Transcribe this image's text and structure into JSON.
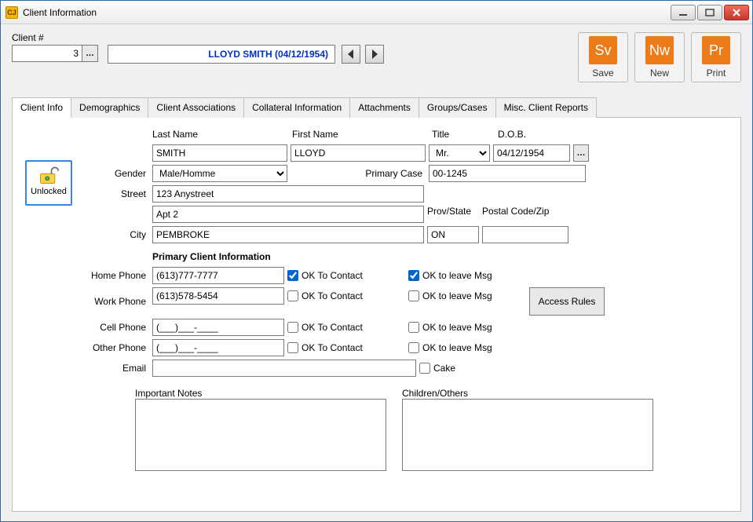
{
  "window": {
    "title": "Client Information"
  },
  "client_number": {
    "label": "Client #",
    "value": "3"
  },
  "banner": {
    "text": "LLOYD SMITH  (04/12/1954)"
  },
  "toolbar": {
    "save": {
      "abbr": "Sv",
      "label": "Save"
    },
    "new": {
      "abbr": "Nw",
      "label": "New"
    },
    "print": {
      "abbr": "Pr",
      "label": "Print"
    }
  },
  "tabs": [
    "Client Info",
    "Demographics",
    "Client Associations",
    "Collateral Information",
    "Attachments",
    "Groups/Cases",
    "Misc. Client Reports"
  ],
  "active_tab": 0,
  "lock": {
    "label": "Unlocked"
  },
  "headers": {
    "last_name": "Last Name",
    "first_name": "First Name",
    "title": "Title",
    "dob": "D.O.B."
  },
  "name": {
    "last": "SMITH",
    "first": "LLOYD",
    "title": "Mr.",
    "dob": "04/12/1954"
  },
  "labels": {
    "gender": "Gender",
    "primary_case": "Primary Case",
    "street": "Street",
    "city": "City",
    "prov": "Prov/State",
    "zip": "Postal Code/Zip",
    "section": "Primary Client Information",
    "home_phone": "Home Phone",
    "work_phone": "Work Phone",
    "cell_phone": "Cell Phone",
    "other_phone": "Other Phone",
    "email": "Email",
    "ok_contact": "OK To Contact",
    "ok_msg": "OK to leave Msg",
    "cake": "Cake",
    "access_rules": "Access Rules",
    "important_notes": "Important Notes",
    "children_others": "Children/Others"
  },
  "gender": "Male/Homme",
  "primary_case": "00-1245",
  "street1": "123 Anystreet",
  "street2": "Apt 2",
  "city": "PEMBROKE",
  "prov": "ON",
  "zip": "",
  "phones": {
    "home": {
      "value": "(613)777-7777",
      "contact": true,
      "msg": true
    },
    "work": {
      "value": "(613)578-5454",
      "contact": false,
      "msg": false
    },
    "cell": {
      "value": "(___)___-____",
      "contact": false,
      "msg": false
    },
    "other": {
      "value": "(___)___-____",
      "contact": false,
      "msg": false
    }
  },
  "email": "",
  "cake": false,
  "important_notes": "",
  "children_others": ""
}
